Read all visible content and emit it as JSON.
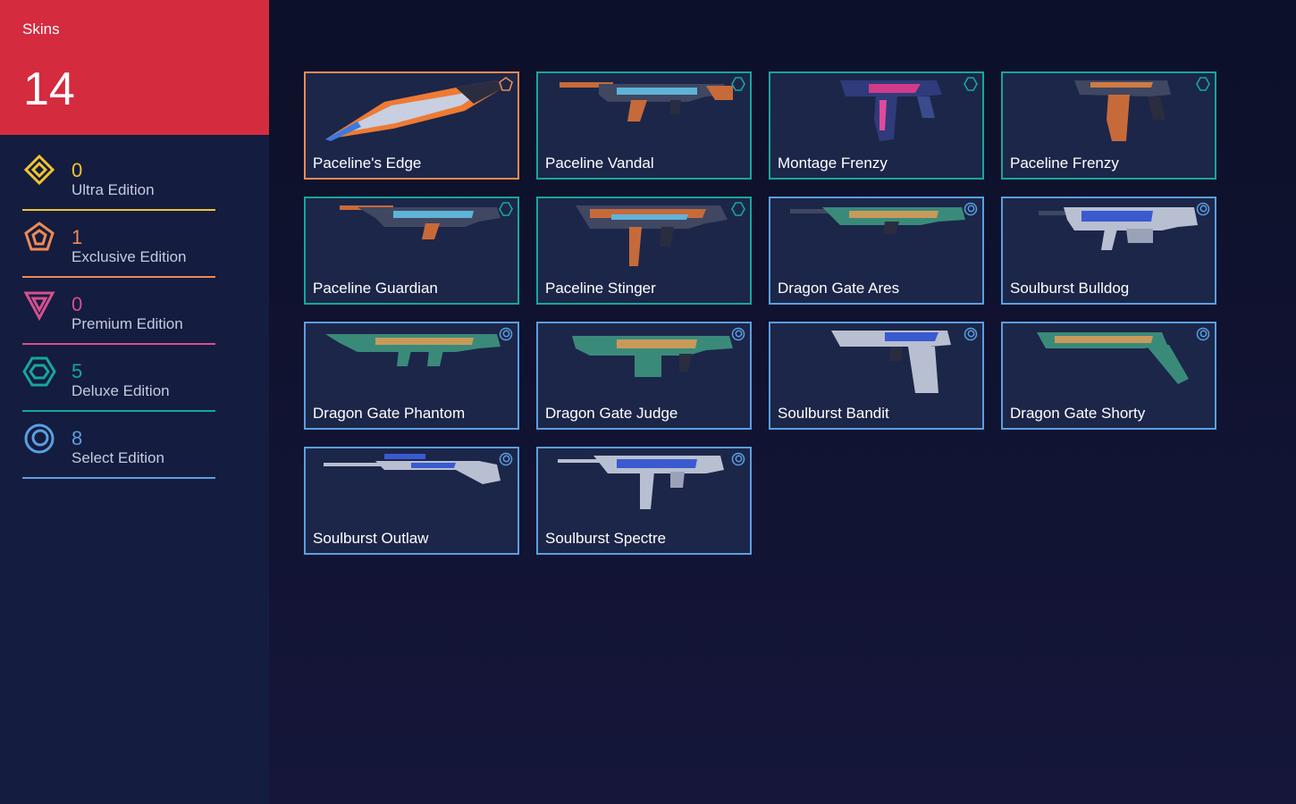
{
  "header": {
    "title": "Skins",
    "count": "14",
    "color": "#d42b3f"
  },
  "tiers": [
    {
      "count": "0",
      "label": "Ultra Edition",
      "color": "#f0c531",
      "icon": "ultra-edition-icon"
    },
    {
      "count": "1",
      "label": "Exclusive Edition",
      "color": "#ee8a54",
      "icon": "exclusive-edition-icon"
    },
    {
      "count": "0",
      "label": "Premium Edition",
      "color": "#d5508e",
      "icon": "premium-edition-icon"
    },
    {
      "count": "5",
      "label": "Deluxe Edition",
      "color": "#16a79a",
      "icon": "deluxe-edition-icon"
    },
    {
      "count": "8",
      "label": "Select Edition",
      "color": "#5a9fe0",
      "icon": "select-edition-icon"
    }
  ],
  "skins": [
    {
      "name": "Paceline's Edge",
      "tier": "exclusive",
      "color": "#ee8a54",
      "icon": "knife-icon"
    },
    {
      "name": "Paceline Vandal",
      "tier": "deluxe",
      "color": "#16a79a",
      "icon": "rifle-icon"
    },
    {
      "name": "Montage Frenzy",
      "tier": "deluxe",
      "color": "#16a79a",
      "icon": "pistol-icon"
    },
    {
      "name": "Paceline Frenzy",
      "tier": "deluxe",
      "color": "#16a79a",
      "icon": "pistol-icon"
    },
    {
      "name": "Paceline Guardian",
      "tier": "deluxe",
      "color": "#16a79a",
      "icon": "rifle-icon"
    },
    {
      "name": "Paceline Stinger",
      "tier": "deluxe",
      "color": "#16a79a",
      "icon": "smg-icon"
    },
    {
      "name": "Dragon Gate Ares",
      "tier": "select",
      "color": "#5a9fe0",
      "icon": "machine-gun-icon"
    },
    {
      "name": "Soulburst Bulldog",
      "tier": "select",
      "color": "#5a9fe0",
      "icon": "rifle-icon"
    },
    {
      "name": "Dragon Gate Phantom",
      "tier": "select",
      "color": "#5a9fe0",
      "icon": "rifle-icon"
    },
    {
      "name": "Dragon Gate Judge",
      "tier": "select",
      "color": "#5a9fe0",
      "icon": "shotgun-icon"
    },
    {
      "name": "Soulburst Bandit",
      "tier": "select",
      "color": "#5a9fe0",
      "icon": "pistol-icon"
    },
    {
      "name": "Dragon Gate Shorty",
      "tier": "select",
      "color": "#5a9fe0",
      "icon": "shotgun-icon"
    },
    {
      "name": "Soulburst Outlaw",
      "tier": "select",
      "color": "#5a9fe0",
      "icon": "sniper-icon"
    },
    {
      "name": "Soulburst Spectre",
      "tier": "select",
      "color": "#5a9fe0",
      "icon": "smg-icon"
    }
  ]
}
